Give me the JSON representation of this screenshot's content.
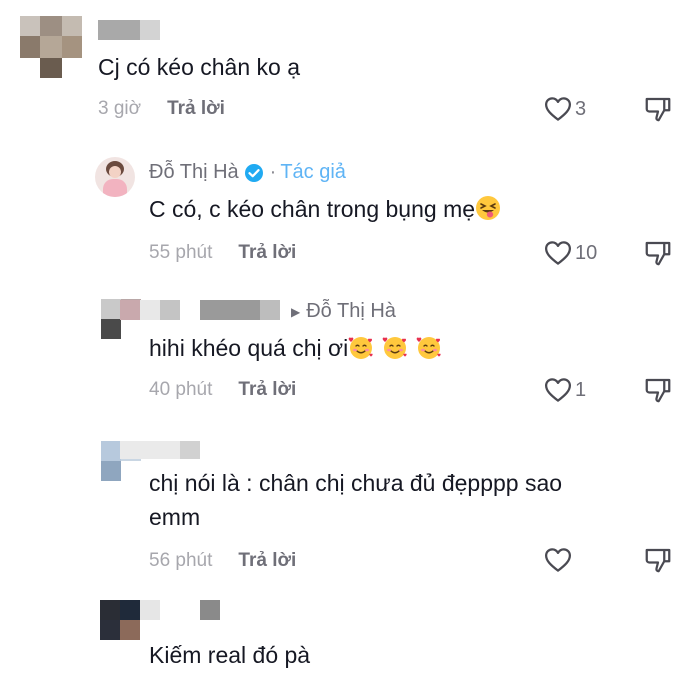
{
  "comments": [
    {
      "text": "Cj có kéo chân ko ạ",
      "time": "3 giờ",
      "reply": "Trả lời",
      "likes": "3",
      "like_icon": "heart-outline-icon",
      "dislike_icon": "thumbs-down-icon"
    },
    {
      "author": "Đỗ Thị Hà",
      "author_badge": "Tác giả",
      "text": "C có, c kéo chân trong bụng mẹ",
      "emoji": "squinting-face-with-tongue",
      "time": "55 phút",
      "reply": "Trả lời",
      "likes": "10"
    },
    {
      "reply_to": "Đỗ Thị Hà",
      "text": "hihi khéo quá chị ơi",
      "emoji": "smiling-face-with-hearts",
      "time": "40 phút",
      "reply": "Trả lời",
      "likes": "1"
    },
    {
      "text_line1": "chị nói là : chân chị chưa đủ đẹpppp sao",
      "text_line2": "emm",
      "time": "56 phút",
      "reply": "Trả lời"
    },
    {
      "text": "Kiếm real đó pà"
    }
  ],
  "colors": {
    "verified": "#20aaf2",
    "author_tag": "#5fb4f5",
    "text": "#161823",
    "muted": "#a7a7ad"
  }
}
